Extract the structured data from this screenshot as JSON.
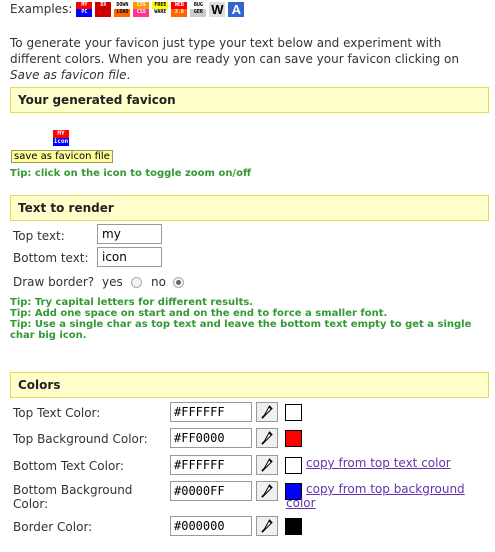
{
  "examples": {
    "label": "Examples:",
    "icons": [
      {
        "name": "my-pc",
        "top": "MY",
        "bottom": "PC",
        "fg": "#ffffff",
        "bgTop": "#ff0000",
        "bgBottom": "#0000ff"
      },
      {
        "name": "dx",
        "top": "DX",
        "bottom": "",
        "fg": "#ffffff",
        "bgTop": "#cc0000",
        "bgBottom": "#cc0000"
      },
      {
        "name": "down-load",
        "top": "DOWN",
        "bottom": "LOAD",
        "fg": "#000000",
        "bgTop": "#ffffff",
        "bgBottom": "#ff6600"
      },
      {
        "name": "css-css",
        "top": "CSS",
        "bottom": "CSS",
        "fg": "#ffffff",
        "bgTop": "#ff9900",
        "bgBottom": "#ff3399"
      },
      {
        "name": "free-ware",
        "top": "FREE",
        "bottom": "WARE",
        "fg": "#000000",
        "bgTop": "#ffff00",
        "bgBottom": "#ffffff"
      },
      {
        "name": "web-20",
        "top": "WEB",
        "bottom": "2.0",
        "fg": "#ffffff",
        "bgTop": "#ff0000",
        "bgBottom": "#ff6600"
      },
      {
        "name": "bug-ger",
        "top": "BUG",
        "bottom": "GER",
        "fg": "#000000",
        "bgTop": "#ffffff",
        "bgBottom": "#cccccc"
      }
    ],
    "big_icons": [
      {
        "name": "w",
        "text": "W",
        "fg": "#000000",
        "bg": "#dddddd"
      },
      {
        "name": "a",
        "text": "A",
        "fg": "#ffffff",
        "bg": "#3366cc"
      }
    ]
  },
  "intro": {
    "text": "To generate your favicon just type your text below and experiment with different colors. When you are ready yon can save your favicon clicking on ",
    "emph": "Save as favicon file",
    "end": "."
  },
  "generated": {
    "title": "Your generated favicon",
    "save_button": "save as favicon file",
    "tip": "Tip: click on the icon to toggle zoom on/off"
  },
  "text_to_render": {
    "title": "Text to render",
    "top_label": "Top text:",
    "top_value": "my",
    "bottom_label": "Bottom text:",
    "bottom_value": "icon",
    "border_label": "Draw border?",
    "yes_label": "yes",
    "no_label": "no",
    "border_selected": "no",
    "tips": [
      "Tip: Try capital letters for different results.",
      "Tip: Add one space on start and on the end to force a smaller font.",
      "Tip: Use a single char as top text and leave the bottom text empty to get a single char big icon."
    ]
  },
  "colors": {
    "title": "Colors",
    "rows": [
      {
        "label": "Top Text Color:",
        "value": "#FFFFFF",
        "swatch": "#FFFFFF",
        "link": ""
      },
      {
        "label": "Top Background Color:",
        "value": "#FF0000",
        "swatch": "#FF0000",
        "link": ""
      },
      {
        "label": "Bottom Text Color:",
        "value": "#FFFFFF",
        "swatch": "#FFFFFF",
        "link": "copy from top text color"
      },
      {
        "label": "Bottom Background Color:",
        "value": "#0000FF",
        "swatch": "#0000FF",
        "link": "copy from top background color"
      },
      {
        "label": "Border Color:",
        "value": "#000000",
        "swatch": "#000000",
        "link": ""
      }
    ]
  },
  "preview": {
    "top_text": "MY",
    "bottom_text": "icon"
  }
}
